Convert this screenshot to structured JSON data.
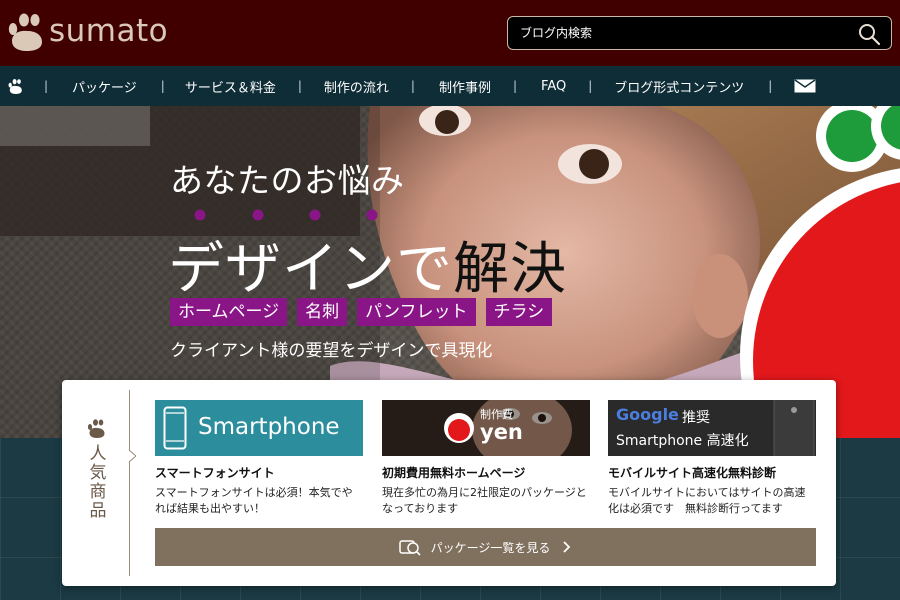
{
  "header": {
    "logo_text": "sumato",
    "search_placeholder": "ブログ内検索"
  },
  "nav": {
    "items": [
      {
        "label": "パッケージ"
      },
      {
        "label": "サービス＆料金"
      },
      {
        "label": "制作の流れ"
      },
      {
        "label": "制作事例"
      },
      {
        "label": "FAQ"
      },
      {
        "label": "ブログ形式コンテンツ"
      }
    ],
    "separator": "|"
  },
  "hero": {
    "subtitle": "あなたのお悩み",
    "main_light": "デザインで",
    "main_dark": "解決",
    "tags": [
      "ホームページ",
      "名刺",
      "パンフレット",
      "チラシ"
    ],
    "caption": "クライアント様の要望をデザインで具現化"
  },
  "products": {
    "title": "人気商品",
    "cards": [
      {
        "banner": "Smartphone",
        "title": "スマートフォンサイト",
        "description": "スマートフォンサイトは必須！本気でやれば結果も出やすい！"
      },
      {
        "banner_small": "制作費",
        "banner_big": "yen",
        "title": "初期費用無料ホームページ",
        "description": "現在多忙の為月に2社限定のパッケージとなっております"
      },
      {
        "banner_google": "Google",
        "banner_line1": "推奨",
        "banner_line2": "Smartphone 高速化",
        "title": "モバイルサイト高速化無料診断",
        "description": "モバイルサイトにおいてはサイトの高速化は必須です　無料診断行ってます"
      }
    ],
    "all_button": "パッケージ一覧を見る"
  },
  "colors": {
    "header_bg": "#410000",
    "nav_bg": "#0f2d37",
    "tag_purple": "#8a1586",
    "button_brown": "#80705e",
    "accent_red": "#e2181b",
    "accent_green": "#1e9b3a",
    "smartphone_teal": "#2c8e9c"
  },
  "icons": [
    "apple-logo-icon",
    "search-icon",
    "home-apple-icon",
    "mail-icon",
    "smartphone-icon",
    "package-list-icon",
    "chevron-right-icon"
  ]
}
